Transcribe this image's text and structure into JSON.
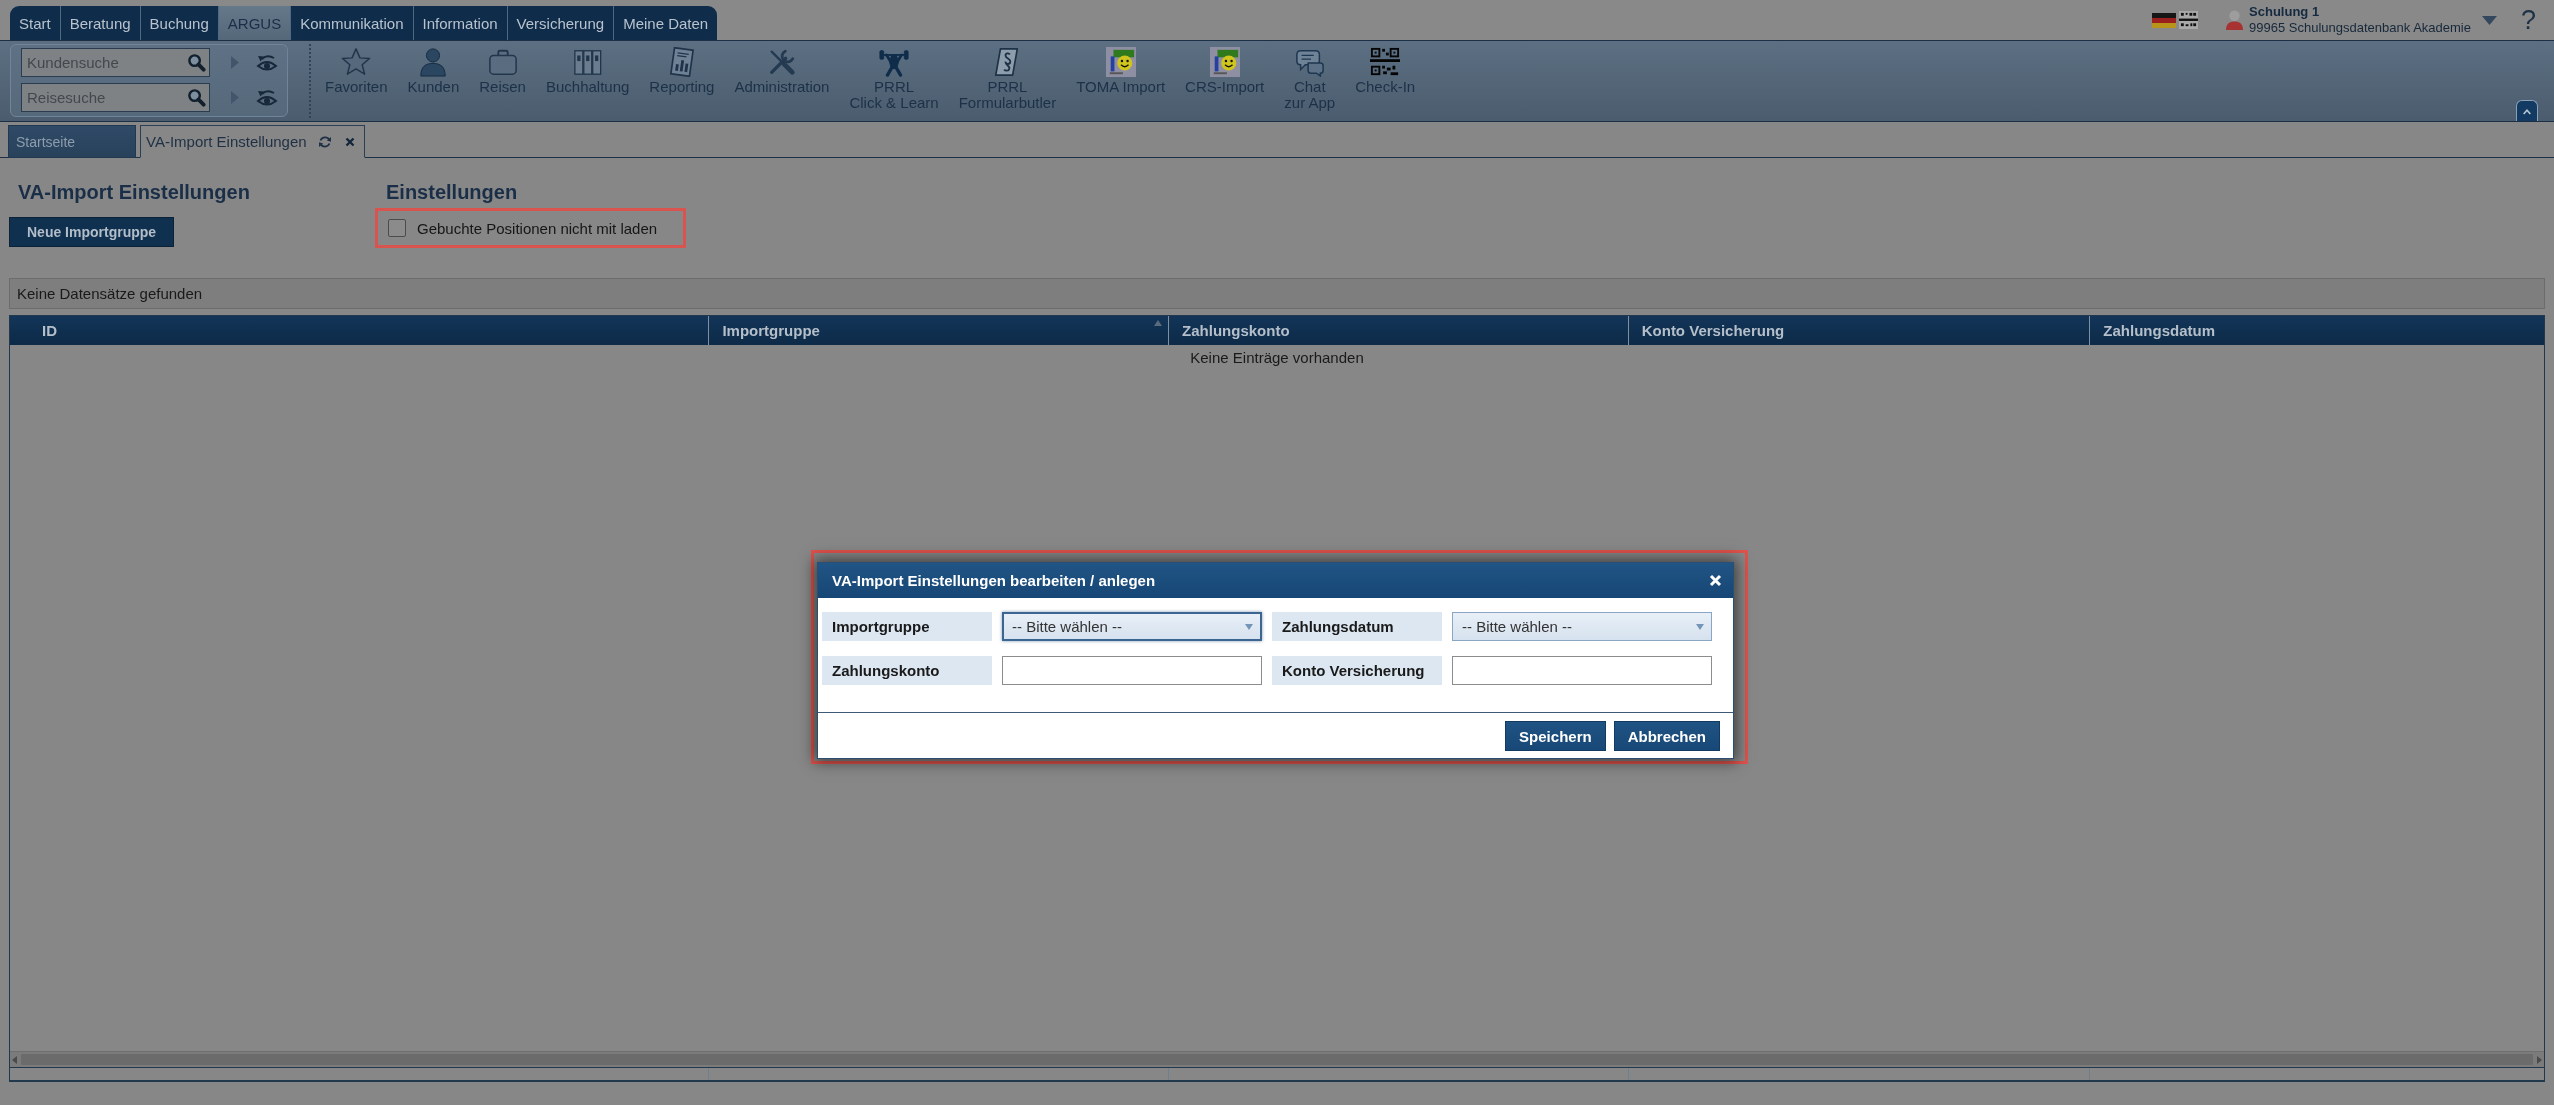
{
  "nav": {
    "tabs": [
      {
        "label": "Start",
        "selected": false
      },
      {
        "label": "Beratung",
        "selected": false
      },
      {
        "label": "Buchung",
        "selected": false
      },
      {
        "label": "ARGUS",
        "selected": true
      },
      {
        "label": "Kommunikation",
        "selected": false
      },
      {
        "label": "Information",
        "selected": false
      },
      {
        "label": "Versicherung",
        "selected": false
      },
      {
        "label": "Meine Daten",
        "selected": false
      }
    ]
  },
  "user": {
    "name": "Schulung 1",
    "company": "99965 Schulungsdatenbank Akademie"
  },
  "help": "?",
  "quick_search": [
    {
      "placeholder": "Kundensuche"
    },
    {
      "placeholder": "Reisesuche"
    }
  ],
  "toolbar": [
    {
      "label_lines": [
        "Favoriten"
      ]
    },
    {
      "label_lines": [
        "Kunden"
      ]
    },
    {
      "label_lines": [
        "Reisen"
      ]
    },
    {
      "label_lines": [
        "Buchhaltung"
      ]
    },
    {
      "label_lines": [
        "Reporting"
      ]
    },
    {
      "label_lines": [
        "Administration"
      ]
    },
    {
      "label_lines": [
        "PRRL",
        "Click & Learn"
      ]
    },
    {
      "label_lines": [
        "PRRL",
        "Formularbutler"
      ]
    },
    {
      "label_lines": [
        "TOMA Import"
      ]
    },
    {
      "label_lines": [
        "CRS-Import"
      ]
    },
    {
      "label_lines": [
        "Chat",
        "zur App"
      ]
    },
    {
      "label_lines": [
        "Check-In"
      ]
    }
  ],
  "page_tabs": [
    {
      "label": "Startseite",
      "selected": false,
      "refreshable": false,
      "closable": false
    },
    {
      "label": "VA-Import Einstellungen",
      "selected": true,
      "refreshable": true,
      "closable": true
    }
  ],
  "page": {
    "title": "VA-Import Einstellungen",
    "button": "Neue Importgruppe"
  },
  "settings": {
    "title": "Einstellungen",
    "options": [
      {
        "label": "Gebuchte Positionen nicht mit laden",
        "checked": false,
        "highlighted": true
      }
    ]
  },
  "table": {
    "status": "Keine Datensätze gefunden",
    "columns": [
      {
        "label": "ID",
        "sorted": false
      },
      {
        "label": "Importgruppe",
        "sorted": true
      },
      {
        "label": "Zahlungskonto",
        "sorted": false
      },
      {
        "label": "Konto Versicherung",
        "sorted": false
      },
      {
        "label": "Zahlungsdatum",
        "sorted": false
      }
    ],
    "empty_text": "Keine Einträge vorhanden"
  },
  "dialog": {
    "title": "VA-Import Einstellungen bearbeiten / anlegen",
    "highlighted": true,
    "fields": [
      {
        "label": "Importgruppe",
        "kind": "select",
        "value": "-- Bitte wählen --",
        "focused": true
      },
      {
        "label": "Zahlungsdatum",
        "kind": "select",
        "value": "-- Bitte wählen --",
        "focused": false
      },
      {
        "label": "Zahlungskonto",
        "kind": "text",
        "focused": false
      },
      {
        "label": "Konto Versicherung",
        "kind": "text",
        "focused": false
      }
    ],
    "buttons": [
      "Speichern",
      "Abbrechen"
    ]
  }
}
